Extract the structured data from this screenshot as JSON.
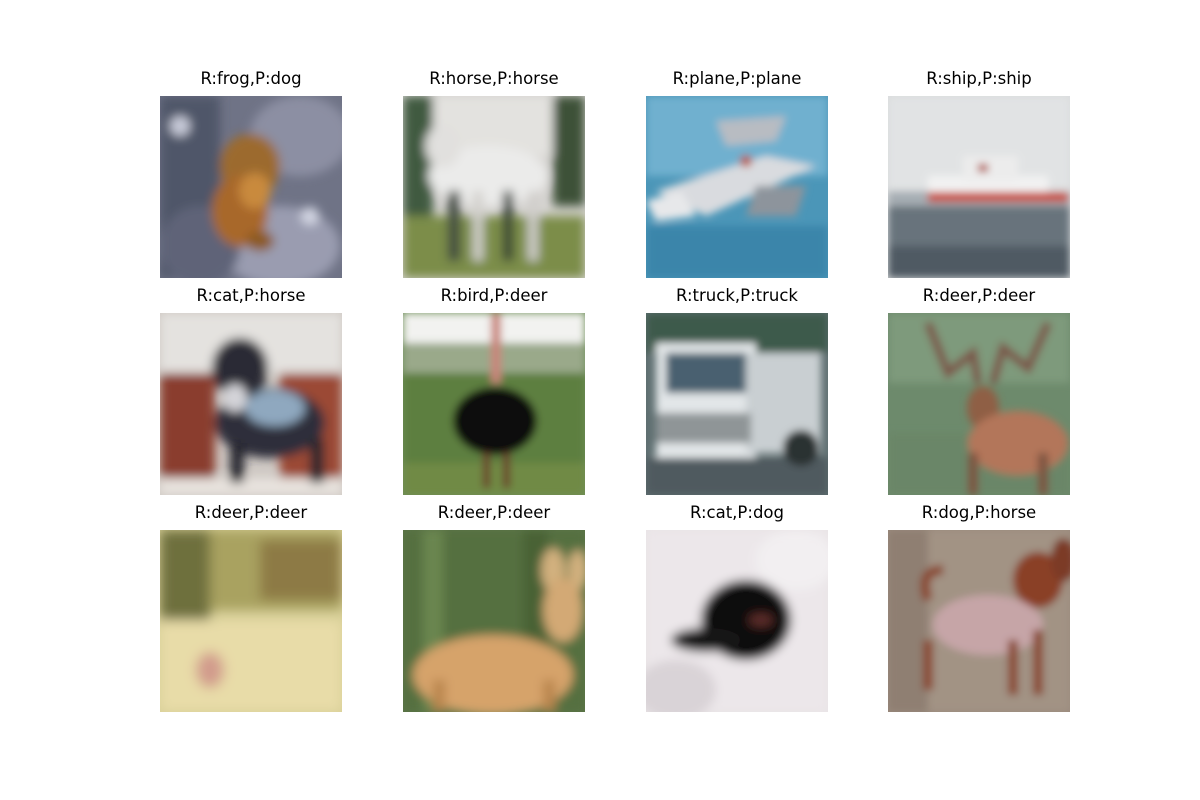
{
  "figure": {
    "panels": [
      {
        "id": "frog-dog",
        "title": "R:frog,P:dog",
        "real": "frog",
        "predicted": "dog"
      },
      {
        "id": "horse-horse",
        "title": "R:horse,P:horse",
        "real": "horse",
        "predicted": "horse"
      },
      {
        "id": "plane-plane",
        "title": "R:plane,P:plane",
        "real": "plane",
        "predicted": "plane"
      },
      {
        "id": "ship-ship",
        "title": "R:ship,P:ship",
        "real": "ship",
        "predicted": "ship"
      },
      {
        "id": "cat-horse",
        "title": "R:cat,P:horse",
        "real": "cat",
        "predicted": "horse"
      },
      {
        "id": "bird-deer",
        "title": "R:bird,P:deer",
        "real": "bird",
        "predicted": "deer"
      },
      {
        "id": "truck-truck",
        "title": "R:truck,P:truck",
        "real": "truck",
        "predicted": "truck"
      },
      {
        "id": "deer-deer-1",
        "title": "R:deer,P:deer",
        "real": "deer",
        "predicted": "deer"
      },
      {
        "id": "deer-deer-2",
        "title": "R:deer,P:deer",
        "real": "deer",
        "predicted": "deer"
      },
      {
        "id": "deer-deer-3",
        "title": "R:deer,P:deer",
        "real": "deer",
        "predicted": "deer"
      },
      {
        "id": "cat-dog",
        "title": "R:cat,P:dog",
        "real": "cat",
        "predicted": "dog"
      },
      {
        "id": "dog-horse",
        "title": "R:dog,P:horse",
        "real": "dog",
        "predicted": "horse"
      }
    ]
  }
}
